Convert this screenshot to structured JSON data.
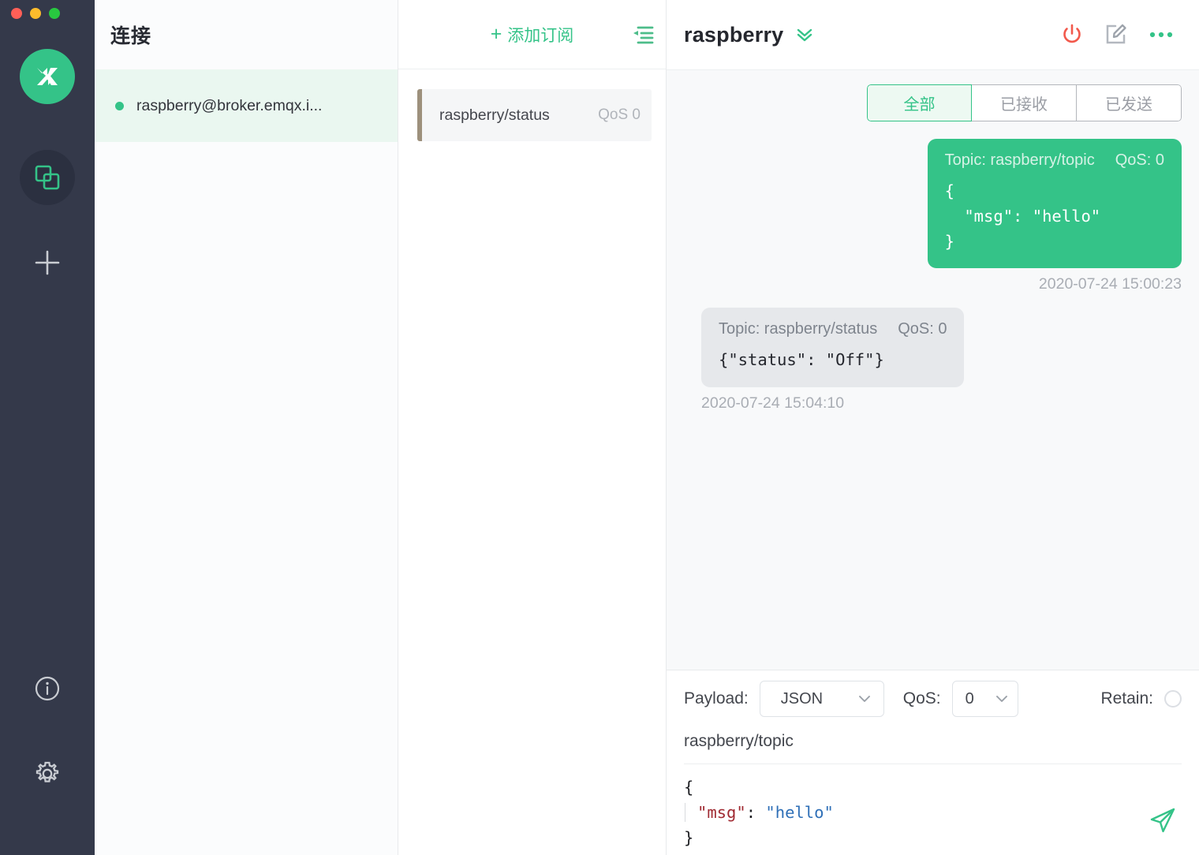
{
  "window": {
    "traffic_lights": [
      "close",
      "minimize",
      "maximize"
    ],
    "colors": {
      "accent_green": "#34c388",
      "rail_bg": "#34394a",
      "annotation_red": "#fa0a07",
      "power_red": "#f2594c",
      "subscription_border": "#9d907c"
    }
  },
  "rail": {
    "logo_name": "mqttx-logo",
    "items": [
      {
        "name": "connections-icon",
        "active": true
      },
      {
        "name": "add-connection-icon",
        "active": false
      },
      {
        "name": "about-info-icon",
        "active": false
      },
      {
        "name": "settings-gear-icon",
        "active": false
      }
    ]
  },
  "connections": {
    "title": "连接",
    "items": [
      {
        "label": "raspberry@broker.emqx.i...",
        "status": "connected",
        "selected": true
      }
    ]
  },
  "subscriptions": {
    "add_label": "添加订阅",
    "add_plus": "+",
    "collapse_icon": "collapse-list-icon",
    "items": [
      {
        "topic": "raspberry/status",
        "qos": "QoS 0"
      }
    ]
  },
  "header": {
    "title": "raspberry",
    "caret_icon": "chevron-double-down-icon",
    "actions": [
      {
        "name": "disconnect-power-button",
        "icon": "power-icon"
      },
      {
        "name": "edit-connection-button",
        "icon": "edit-pencil-icon"
      },
      {
        "name": "more-options-button",
        "icon": "ellipsis-icon"
      }
    ]
  },
  "messages": {
    "tabs": [
      {
        "label": "全部",
        "active": true
      },
      {
        "label": "已接收",
        "active": false
      },
      {
        "label": "已发送",
        "active": false
      }
    ],
    "list": [
      {
        "direction": "out",
        "topic_label": "Topic: raspberry/topic",
        "qos_label": "QoS: 0",
        "payload": "{\n  \"msg\": \"hello\"\n}",
        "time": "2020-07-24 15:00:23",
        "annotated": false
      },
      {
        "direction": "in",
        "topic_label": "Topic: raspberry/status",
        "qos_label": "QoS: 0",
        "payload": "{\"status\": \"Off\"}",
        "time": "2020-07-24 15:04:10",
        "annotated": true
      }
    ]
  },
  "publish": {
    "payload_label": "Payload:",
    "payload_value": "JSON",
    "qos_label": "QoS:",
    "qos_value": "0",
    "retain_label": "Retain:",
    "retain_checked": false,
    "topic": "raspberry/topic",
    "editor": {
      "line1": "{",
      "line2_key": "\"msg\"",
      "line2_colon": ": ",
      "line2_value": "\"hello\"",
      "line3": "}"
    },
    "send_icon": "send-arrow-icon"
  }
}
